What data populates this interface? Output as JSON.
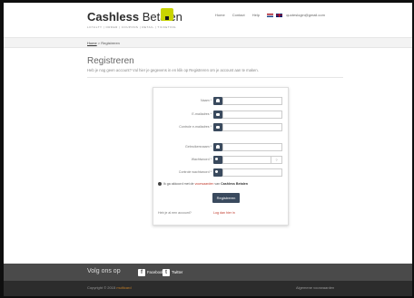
{
  "header": {
    "logo_bold": "Cashless",
    "logo_rest": " Betalen",
    "tagline": "LOYALTY | ORDER | COUPONS | RETAIL | TICKETING",
    "nav": [
      "Home",
      "Contact",
      "Help"
    ],
    "account": "quoteslogin@gmail.com"
  },
  "breadcrumb": {
    "home": "Home",
    "separator": " > ",
    "current": "Registreren"
  },
  "page": {
    "title": "Registreren",
    "subtitle": "Heb je nog geen account? Vul hier je gegevens in en klik op Registreren om je account aan te maken."
  },
  "form": {
    "fields": [
      {
        "label": "Naam *",
        "value": "",
        "icon": "user-icon"
      },
      {
        "label": "E-mailadres *",
        "value": "",
        "icon": "mail-icon"
      },
      {
        "label": "Controle e-mailadres *",
        "value": "",
        "icon": "mail-icon"
      },
      {
        "label": "Gebruikersnaam *",
        "value": "",
        "icon": "user-icon"
      },
      {
        "label": "Wachtwoord *",
        "value": "",
        "icon": "key-icon"
      },
      {
        "label": "Controle wachtwoord *",
        "value": "",
        "icon": "key-icon"
      }
    ],
    "help_mark": "?",
    "agree_prefix": "Ik ga akkoord met de ",
    "agree_link": "voorwaarden",
    "agree_mid": " van ",
    "agree_brand": "Cashless Betalen",
    "submit_label": "Registreren",
    "login_question": "Heb je al een account?",
    "login_link": "Log dan hier in"
  },
  "footer": {
    "social_title": "Volg ons op",
    "facebook": "Facebook",
    "twitter": "Twitter",
    "copyright_prefix": "Copyright © 2015 ",
    "copyright_brand": "multicard",
    "terms": "Algemene voorwaarden"
  },
  "colors": {
    "accent": "#c9d400",
    "button": "#3a4a5e",
    "link": "#c0392b",
    "footer_dark": "#2c2c2c"
  }
}
